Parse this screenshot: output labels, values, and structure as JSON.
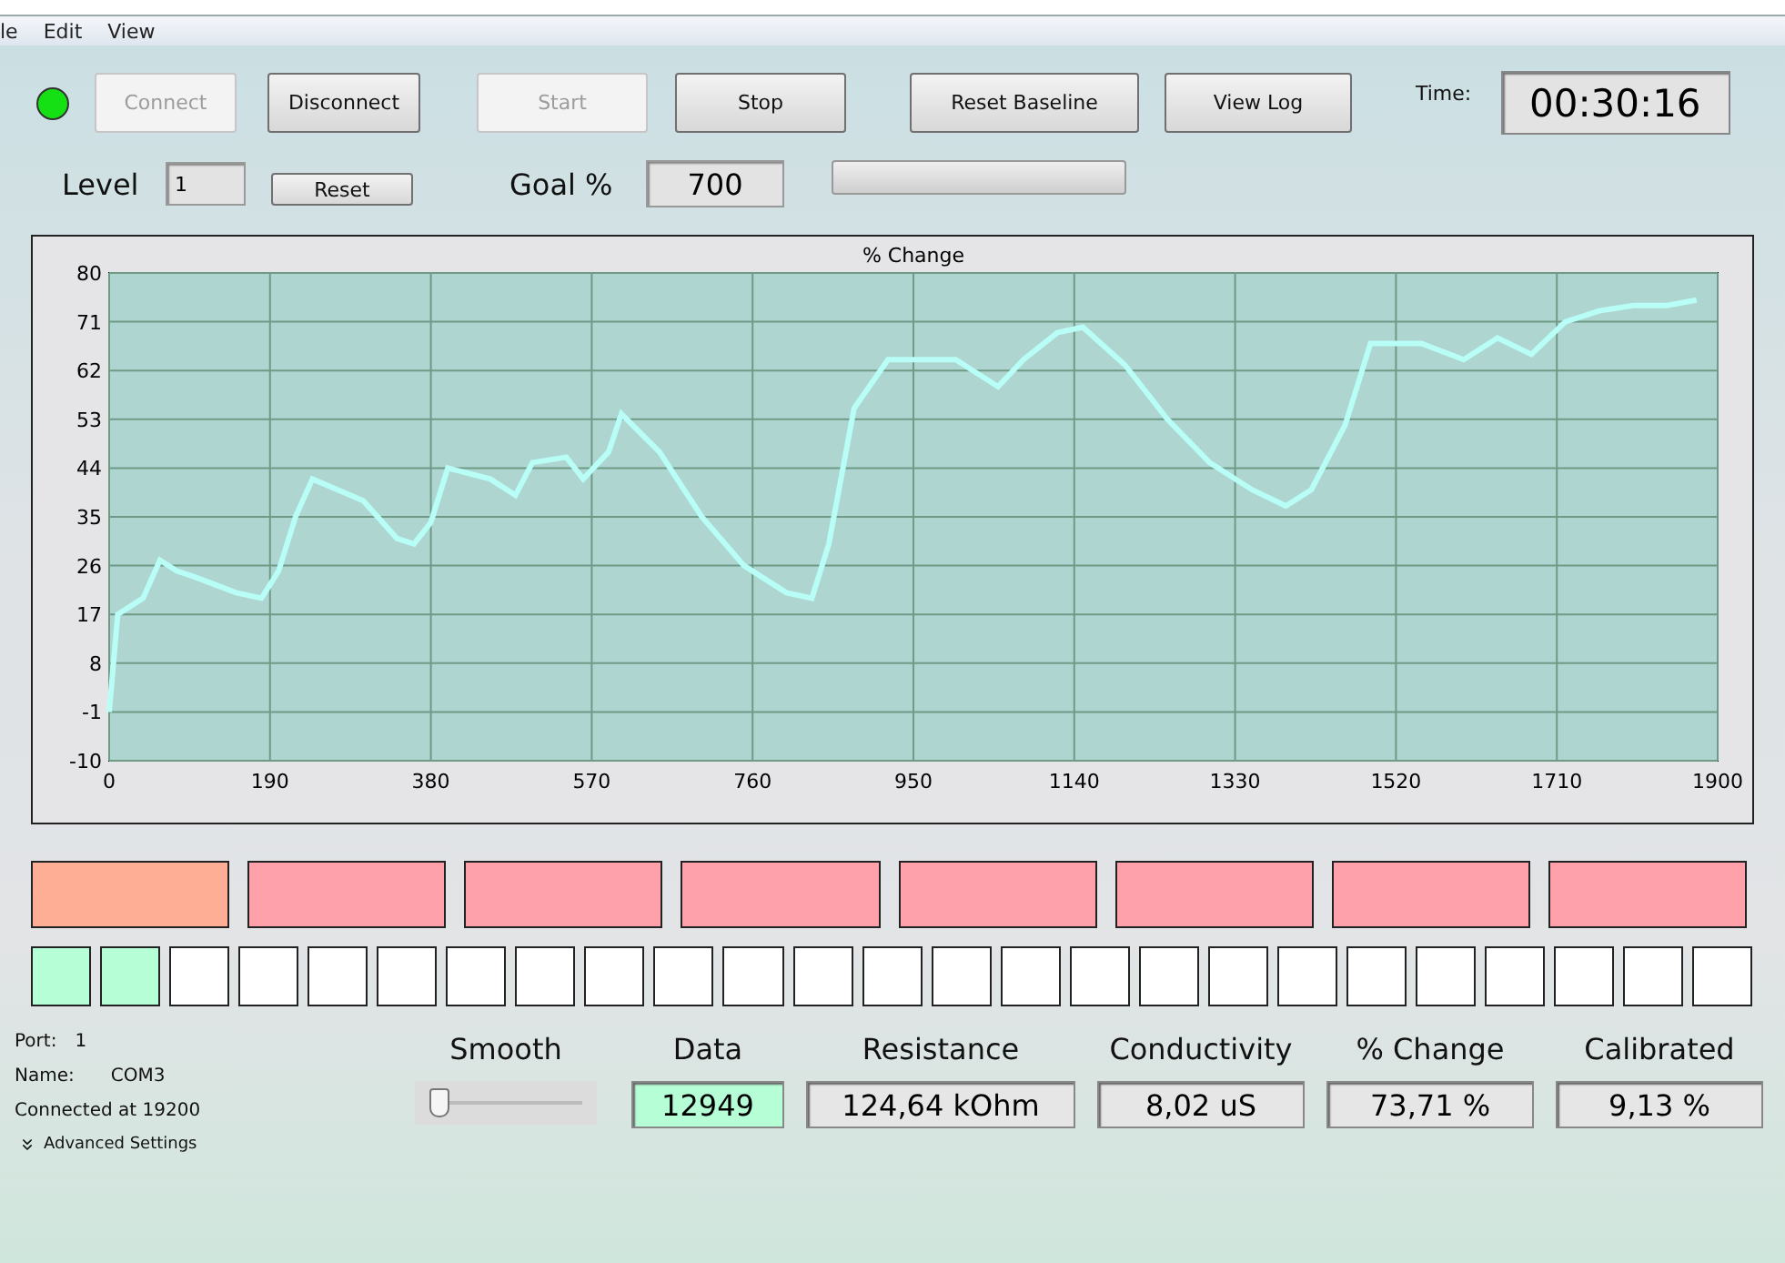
{
  "menu": [
    "le",
    "Edit",
    "View"
  ],
  "status_led": {
    "on": true
  },
  "buttons": [
    {
      "label": "Connect",
      "disabled": true
    },
    {
      "label": "Disconnect",
      "disabled": false
    },
    {
      "label": "Start",
      "disabled": true
    },
    {
      "label": "Stop",
      "disabled": false
    },
    {
      "label": "Reset Baseline",
      "disabled": false
    },
    {
      "label": "View Log",
      "disabled": false
    }
  ],
  "time": {
    "label": "Time:",
    "value": "00:30:16"
  },
  "level": {
    "label": "Level",
    "value": "1",
    "reset": "Reset"
  },
  "goal": {
    "label": "Goal %",
    "value": "700"
  },
  "progress": {
    "level": 0
  },
  "chart_data": {
    "type": "line",
    "title": "% Change",
    "grid": true,
    "xlim": [
      0,
      1900
    ],
    "ylim": [
      -10,
      80
    ],
    "xticks": [
      0,
      190,
      380,
      570,
      760,
      950,
      1140,
      1330,
      1520,
      1710,
      1900
    ],
    "yticks": [
      -10,
      -1,
      8,
      17,
      26,
      35,
      44,
      53,
      62,
      71,
      80
    ],
    "x": [
      0,
      10,
      40,
      60,
      80,
      100,
      150,
      180,
      200,
      220,
      240,
      300,
      340,
      360,
      380,
      400,
      450,
      480,
      500,
      540,
      560,
      590,
      605,
      650,
      700,
      750,
      800,
      830,
      850,
      880,
      920,
      950,
      1000,
      1050,
      1080,
      1120,
      1150,
      1200,
      1250,
      1300,
      1350,
      1390,
      1420,
      1460,
      1490,
      1550,
      1600,
      1640,
      1680,
      1720,
      1760,
      1800,
      1840,
      1875
    ],
    "series": [
      {
        "color": "#b8fdf6",
        "values": [
          -1,
          17,
          20,
          27,
          25,
          24,
          21,
          20,
          25,
          35,
          42,
          38,
          31,
          30,
          34,
          44,
          42,
          39,
          45,
          46,
          42,
          47,
          54,
          47,
          35,
          26,
          21,
          20,
          30,
          55,
          64,
          64,
          64,
          59,
          64,
          69,
          70,
          63,
          53,
          45,
          40,
          37,
          40,
          52,
          67,
          67,
          64,
          68,
          65,
          71,
          73,
          74,
          74,
          75
        ]
      }
    ]
  },
  "blocks": [
    {
      "color": "#fdae94"
    },
    {
      "color": "#fea1ab"
    },
    {
      "color": "#fea1ab"
    },
    {
      "color": "#fea1ab"
    },
    {
      "color": "#fea1ab"
    },
    {
      "color": "#fea1ab"
    },
    {
      "color": "#fea1ab"
    },
    {
      "color": "#fea1ab"
    }
  ],
  "cells": [
    {
      "on": true
    },
    {
      "on": true
    },
    {
      "on": false
    },
    {
      "on": false
    },
    {
      "on": false
    },
    {
      "on": false
    },
    {
      "on": false
    },
    {
      "on": false
    },
    {
      "on": false
    },
    {
      "on": false
    },
    {
      "on": false
    },
    {
      "on": false
    },
    {
      "on": false
    },
    {
      "on": false
    },
    {
      "on": false
    },
    {
      "on": false
    },
    {
      "on": false
    },
    {
      "on": false
    },
    {
      "on": false
    },
    {
      "on": false
    },
    {
      "on": false
    },
    {
      "on": false
    },
    {
      "on": false
    },
    {
      "on": false
    },
    {
      "on": false
    }
  ],
  "port": {
    "label": "Port:",
    "value": "1"
  },
  "name": {
    "label": "Name:",
    "value": "COM3"
  },
  "connection": "Connected at 19200",
  "advanced": "Advanced Settings",
  "smooth": {
    "label": "Smooth",
    "level": 0.05
  },
  "readouts": [
    {
      "label": "Data",
      "value": "12949",
      "highlighted": true
    },
    {
      "label": "Resistance",
      "value": "124,64 kOhm",
      "highlighted": false
    },
    {
      "label": "Conductivity",
      "value": "8,02 uS",
      "highlighted": false
    },
    {
      "label": "% Change",
      "value": "73,71 %",
      "highlighted": false
    },
    {
      "label": "Calibrated",
      "value": "9,13 %",
      "highlighted": false
    }
  ]
}
